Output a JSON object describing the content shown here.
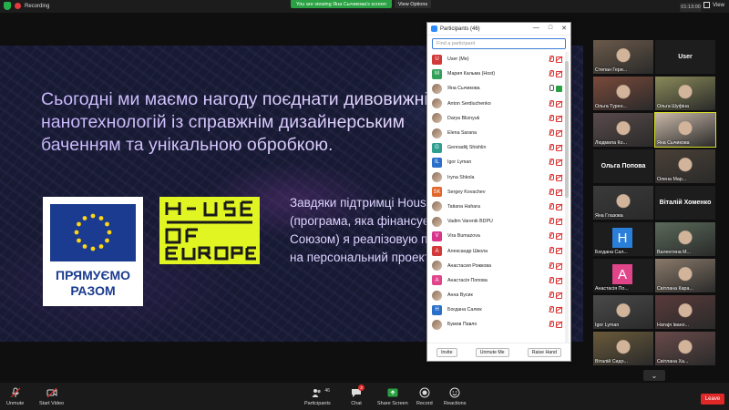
{
  "topbar": {
    "recording_label": "Recording",
    "viewing_banner": "You are viewing Яна Сычикова's screen",
    "view_options_label": "View Options",
    "clock": "01:13:00",
    "view_label": "View"
  },
  "slide": {
    "lines": [
      "Сьогодні ми маємо нагоду поєднати дивовижні",
      "нанотехнологій із справжнім дизайнерським",
      "баченням та унікальною обробкою."
    ],
    "body_lines": [
      "Завдяки підтримці Hous",
      "(програма, яка фінансує",
      "Союзом) я реалізовую п",
      "на персональний проект"
    ],
    "eu_logo_text": [
      "ПРЯМУЄМО",
      "РАЗОМ"
    ]
  },
  "participants": {
    "title": "Participants (46)",
    "search_placeholder": "Find a participant",
    "items": [
      {
        "name": "User (Me)",
        "initial": "U",
        "color": "#d23a3a",
        "photo": false,
        "mic_on": false,
        "cam_on": false
      },
      {
        "name": "Мария Кальма (Host)",
        "initial": "M",
        "color": "#33a05a",
        "photo": false,
        "mic_on": false,
        "cam_on": false
      },
      {
        "name": "Яна Сычикова",
        "initial": "",
        "color": "#8a6d5b",
        "photo": true,
        "mic_on": true,
        "cam_on": true
      },
      {
        "name": "Anton Serdiuchenko",
        "initial": "",
        "color": "#8a6d5b",
        "photo": true,
        "mic_on": false,
        "cam_on": false
      },
      {
        "name": "Darya Bliznyuk",
        "initial": "",
        "color": "#8a6d5b",
        "photo": true,
        "mic_on": false,
        "cam_on": false
      },
      {
        "name": "Elena Sarana",
        "initial": "",
        "color": "#8a6d5b",
        "photo": true,
        "mic_on": false,
        "cam_on": false
      },
      {
        "name": "Gennadiij Shishlin",
        "initial": "G",
        "color": "#2f9e8f",
        "photo": false,
        "mic_on": false,
        "cam_on": false
      },
      {
        "name": "Igor Lyman",
        "initial": "IL",
        "color": "#2a6fc9",
        "photo": false,
        "mic_on": false,
        "cam_on": false
      },
      {
        "name": "Iryna Shkola",
        "initial": "",
        "color": "#8a6d5b",
        "photo": true,
        "mic_on": false,
        "cam_on": false
      },
      {
        "name": "Sergey Kovachev",
        "initial": "SK",
        "color": "#e0662a",
        "photo": false,
        "mic_on": false,
        "cam_on": false
      },
      {
        "name": "Tatiana Hahara",
        "initial": "",
        "color": "#8a6d5b",
        "photo": true,
        "mic_on": false,
        "cam_on": false
      },
      {
        "name": "Vadim Varenik BDPU",
        "initial": "",
        "color": "#8a6d5b",
        "photo": true,
        "mic_on": false,
        "cam_on": false
      },
      {
        "name": "Vira Bumazova",
        "initial": "V",
        "color": "#d6358a",
        "photo": false,
        "mic_on": false,
        "cam_on": false
      },
      {
        "name": "Александр Школа",
        "initial": "A",
        "color": "#d23a3a",
        "photo": false,
        "mic_on": false,
        "cam_on": false
      },
      {
        "name": "Анастасия Рожкова",
        "initial": "",
        "color": "#8a6d5b",
        "photo": true,
        "mic_on": false,
        "cam_on": false
      },
      {
        "name": "Анастасія Попова",
        "initial": "A",
        "color": "#e0458a",
        "photo": false,
        "mic_on": false,
        "cam_on": false
      },
      {
        "name": "Анна Вусик",
        "initial": "",
        "color": "#8a6d5b",
        "photo": true,
        "mic_on": false,
        "cam_on": false
      },
      {
        "name": "Богдана Салюк",
        "initial": "H",
        "color": "#2a6fc9",
        "photo": false,
        "mic_on": false,
        "cam_on": false
      },
      {
        "name": "Бумов Павло",
        "initial": "",
        "color": "#8a6d5b",
        "photo": true,
        "mic_on": false,
        "cam_on": false
      }
    ],
    "footer": {
      "invite": "Invite",
      "unmute_me": "Unmute Me",
      "raise_hand": "Raise Hand"
    }
  },
  "gallery": {
    "tiles": [
      {
        "name": "Степан Гери...",
        "type": "photo",
        "bg": "#6b5a4a"
      },
      {
        "name": "User",
        "type": "text",
        "bg": "#1d1d1d"
      },
      {
        "name": "Ольга Турен...",
        "type": "photo",
        "bg": "#7a4a3a"
      },
      {
        "name": "Ольга Шуфіна",
        "type": "photo",
        "bg": "#8a8a5a"
      },
      {
        "name": "Людмила Ко...",
        "type": "photo",
        "bg": "#5a4a4a"
      },
      {
        "name": "Яна Сычикова",
        "type": "photo",
        "bg": "#c9b8a8",
        "active": true
      },
      {
        "name": "Ольга Попова",
        "type": "text",
        "bg": "#1d1d1d"
      },
      {
        "name": "Олена Мар...",
        "type": "photo",
        "bg": "#4a4036"
      },
      {
        "name": "Яна Глазова",
        "type": "photo",
        "bg": "#3a3a3a"
      },
      {
        "name": "Віталій Хоменко",
        "type": "text",
        "bg": "#1d1d1d"
      },
      {
        "name": "Богдана Сал...",
        "type": "letter",
        "letter": "H",
        "bg": "#1d1d1d",
        "letter_color": "#2a7fd9"
      },
      {
        "name": "Валентина М...",
        "type": "photo",
        "bg": "#5a6a5a"
      },
      {
        "name": "Анастасія По...",
        "type": "letter",
        "letter": "A",
        "bg": "#1d1d1d",
        "letter_color": "#e0458a"
      },
      {
        "name": "Світлана Кара...",
        "type": "photo",
        "bg": "#8a7a6a"
      },
      {
        "name": "Igor Lyman",
        "type": "photo",
        "bg": "#4a4a4a"
      },
      {
        "name": "Натаjя Івано...",
        "type": "photo",
        "bg": "#5a3a3a"
      },
      {
        "name": "Віталій Сидо...",
        "type": "photo",
        "bg": "#6a5a3a"
      },
      {
        "name": "Світлана Ха...",
        "type": "photo",
        "bg": "#6a4a4a"
      }
    ]
  },
  "toolbar": {
    "unmute": "Unmute",
    "start_video": "Start Video",
    "participants": "Participants",
    "participants_count": "46",
    "chat": "Chat",
    "chat_badge": "3",
    "share_screen": "Share Screen",
    "record": "Record",
    "reactions": "Reactions",
    "leave": "Leave"
  }
}
